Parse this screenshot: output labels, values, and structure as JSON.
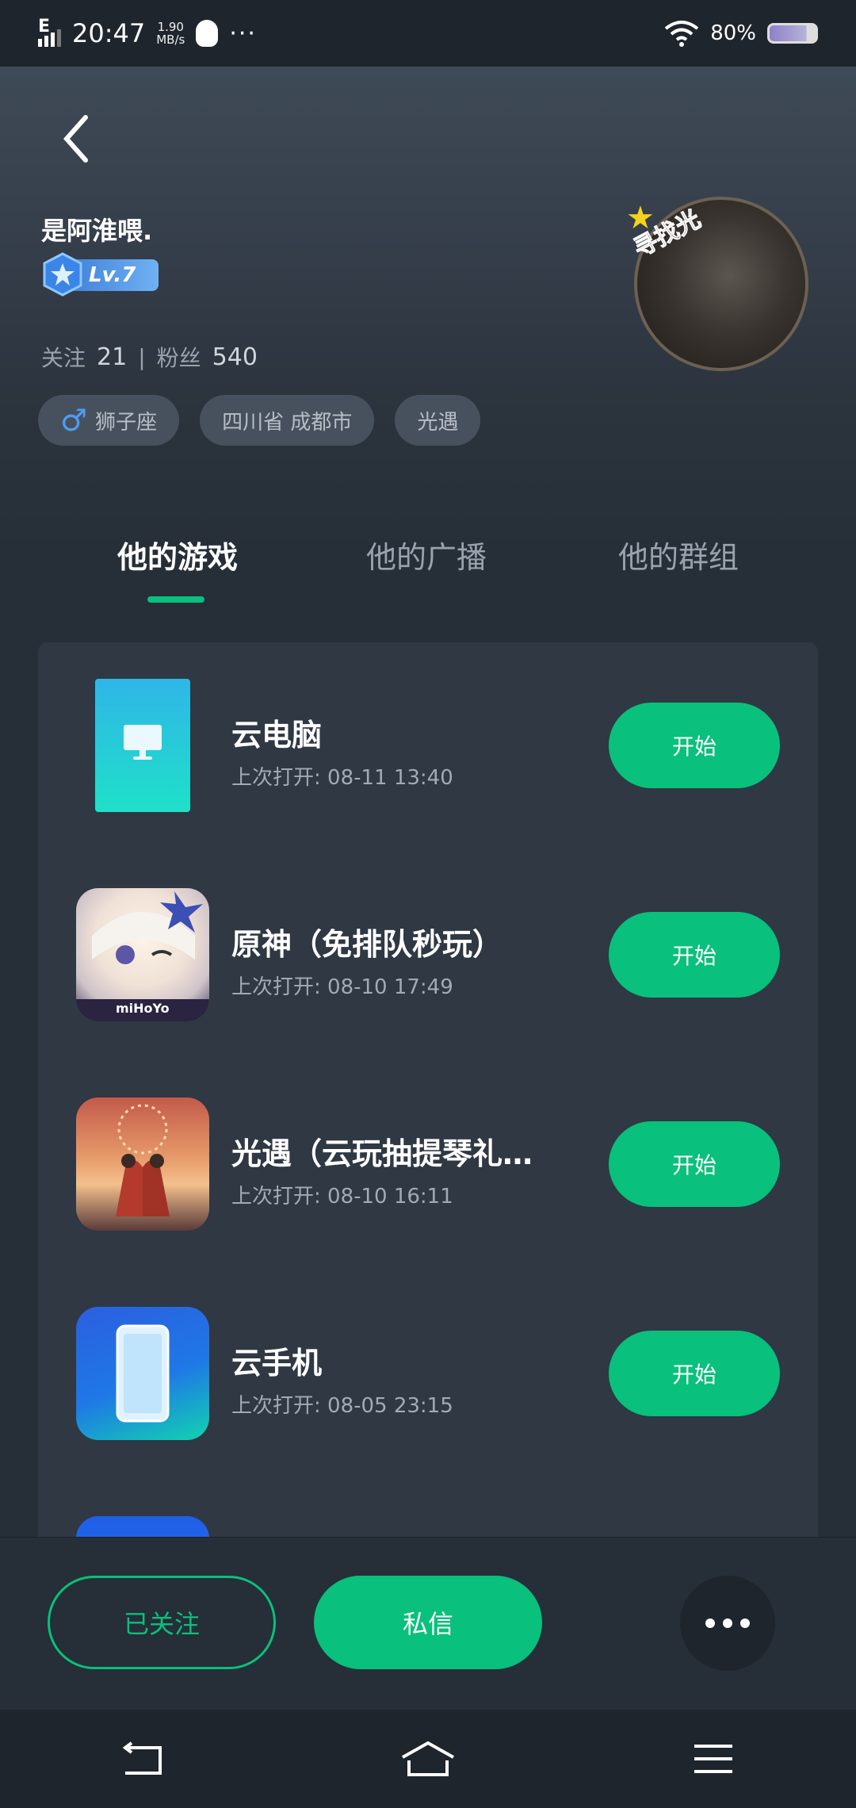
{
  "status_bar": {
    "network": "E",
    "time": "20:47",
    "speed_value": "1.90",
    "speed_unit": "MB/s",
    "more": "···",
    "battery": "80%"
  },
  "profile": {
    "nickname": "是阿淮喂.",
    "level": "Lv.7",
    "follow_label": "关注",
    "follow_count": "21",
    "separator": "|",
    "fans_label": "粉丝",
    "fans_count": "540",
    "tags": [
      "狮子座",
      "四川省 成都市",
      "光遇"
    ],
    "avatar_frame_text": "寻找光"
  },
  "tabs": [
    "他的游戏",
    "他的广播",
    "他的群组"
  ],
  "games": [
    {
      "name": "云电脑",
      "last_open": "上次打开: 08-11 13:40",
      "button": "开始"
    },
    {
      "name": "原神（免排队秒玩）",
      "last_open": "上次打开: 08-10 17:49",
      "button": "开始",
      "icon_text": "miHoYo"
    },
    {
      "name": "光遇（云玩抽提琴礼…",
      "last_open": "上次打开: 08-10 16:11",
      "button": "开始"
    },
    {
      "name": "云手机",
      "last_open": "上次打开: 08-05 23:15",
      "button": "开始"
    }
  ],
  "actions": {
    "followed": "已关注",
    "message": "私信"
  },
  "colors": {
    "accent": "#09c07c",
    "background": "#262e38",
    "card": "#2f3843"
  }
}
